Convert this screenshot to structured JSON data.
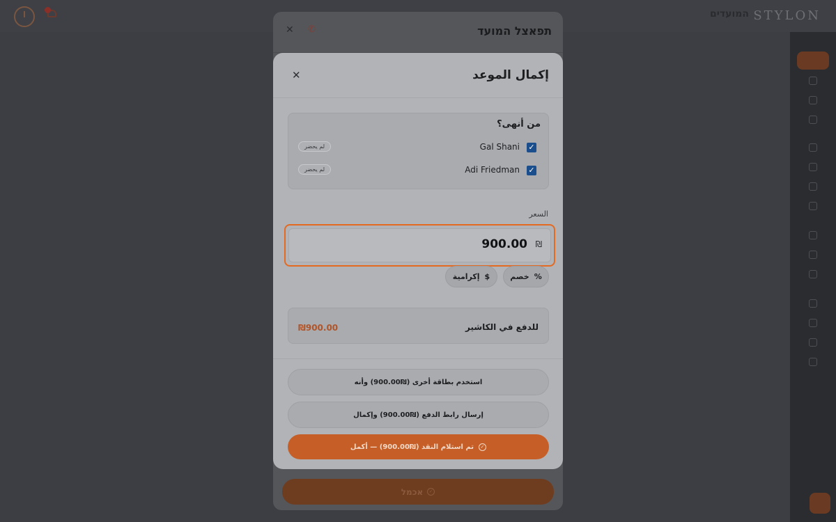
{
  "app": {
    "brand": "STYLON",
    "nav_appointments": "המועדים"
  },
  "details_modal": {
    "title": "תפאצל המועד",
    "complete_label": "אכמל"
  },
  "complete_modal": {
    "title": "إكمال الموعد",
    "who_finished_label": "من أنهى؟",
    "staff": [
      {
        "name": "Gal Shani",
        "checked": true,
        "no_show_label": "لم يحضر"
      },
      {
        "name": "Adi Friedman",
        "checked": true,
        "no_show_label": "لم يحضر"
      }
    ],
    "price_label": "السعر",
    "price_value": "900.00",
    "currency_symbol": "₪",
    "discount_label": "خصم",
    "discount_icon_glyph": "%",
    "tip_label": "إكرامية",
    "tip_icon_glyph": "$",
    "cashier_label": "للدفع في الكاشير",
    "cashier_amount": "₪900.00",
    "actions": {
      "other_card": "استخدم بطاقة أخرى (₪900.00) وأنه",
      "send_link": "إرسال رابط الدفع (₪900.00) وإكمال",
      "cash_received": "تم استلام النقد (₪900.00) — أكمل"
    }
  },
  "colors": {
    "accent": "#e46a22",
    "primary_button": "#c55f27",
    "checkbox": "#1b4e8c"
  }
}
